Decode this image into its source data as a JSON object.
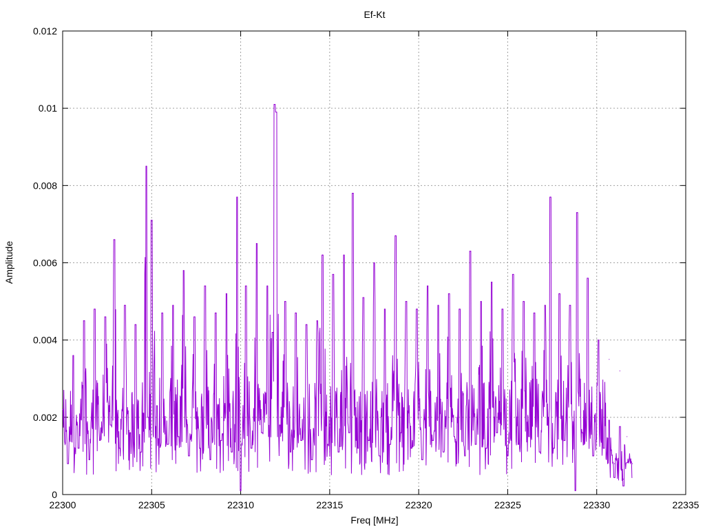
{
  "chart_data": {
    "type": "line",
    "title": "Ef-Kt",
    "xlabel": "Freq [MHz]",
    "ylabel": "Amplitude",
    "xlim": [
      22300,
      22335
    ],
    "ylim": [
      0,
      0.012
    ],
    "x_ticks": [
      "22300",
      "22305",
      "22310",
      "22315",
      "22320",
      "22325",
      "22330",
      "22335"
    ],
    "y_ticks": [
      "0",
      "0.002",
      "0.004",
      "0.006",
      "0.008",
      "0.01",
      "0.012"
    ],
    "grid": true,
    "legend": false,
    "series_color": "#9400d3",
    "x_range": [
      22300,
      22332
    ],
    "points": [
      [
        22300.0,
        0.0022
      ],
      [
        22300.3,
        0.0008
      ],
      [
        22300.6,
        0.0036
      ],
      [
        22300.9,
        0.0012
      ],
      [
        22301.2,
        0.0045
      ],
      [
        22301.5,
        0.0009
      ],
      [
        22301.8,
        0.0048
      ],
      [
        22302.1,
        0.0014
      ],
      [
        22302.4,
        0.0046
      ],
      [
        22302.7,
        0.0018
      ],
      [
        22302.9,
        0.0066
      ],
      [
        22303.2,
        0.0012
      ],
      [
        22303.5,
        0.0049
      ],
      [
        22303.8,
        0.0016
      ],
      [
        22304.1,
        0.0044
      ],
      [
        22304.4,
        0.0011
      ],
      [
        22304.7,
        0.0085
      ],
      [
        22304.8,
        0.002
      ],
      [
        22305.0,
        0.0071
      ],
      [
        22305.3,
        0.0023
      ],
      [
        22305.6,
        0.0047
      ],
      [
        22305.9,
        0.0013
      ],
      [
        22306.2,
        0.0049
      ],
      [
        22306.5,
        0.0015
      ],
      [
        22306.8,
        0.0058
      ],
      [
        22307.1,
        0.001
      ],
      [
        22307.4,
        0.0046
      ],
      [
        22307.7,
        0.0012
      ],
      [
        22308.0,
        0.0054
      ],
      [
        22308.3,
        0.0009
      ],
      [
        22308.6,
        0.0047
      ],
      [
        22308.9,
        0.0014
      ],
      [
        22309.2,
        0.0052
      ],
      [
        22309.5,
        0.0011
      ],
      [
        22309.8,
        0.0077
      ],
      [
        22310.0,
        0.0001
      ],
      [
        22310.3,
        0.0054
      ],
      [
        22310.6,
        0.0012
      ],
      [
        22310.9,
        0.0065
      ],
      [
        22311.2,
        0.0016
      ],
      [
        22311.5,
        0.0054
      ],
      [
        22311.8,
        0.0042
      ],
      [
        22311.9,
        0.0101
      ],
      [
        22312.0,
        0.0099
      ],
      [
        22312.2,
        0.0018
      ],
      [
        22312.5,
        0.005
      ],
      [
        22312.8,
        0.0011
      ],
      [
        22313.1,
        0.0047
      ],
      [
        22313.4,
        0.0014
      ],
      [
        22313.7,
        0.0044
      ],
      [
        22314.0,
        0.0009
      ],
      [
        22314.3,
        0.0045
      ],
      [
        22314.6,
        0.0062
      ],
      [
        22314.9,
        0.0013
      ],
      [
        22315.2,
        0.0057
      ],
      [
        22315.5,
        0.0011
      ],
      [
        22315.8,
        0.0062
      ],
      [
        22316.1,
        0.0016
      ],
      [
        22316.3,
        0.0078
      ],
      [
        22316.6,
        0.0012
      ],
      [
        22316.9,
        0.0051
      ],
      [
        22317.2,
        0.0014
      ],
      [
        22317.5,
        0.006
      ],
      [
        22317.8,
        0.001
      ],
      [
        22318.1,
        0.0048
      ],
      [
        22318.4,
        0.0013
      ],
      [
        22318.7,
        0.0067
      ],
      [
        22319.0,
        0.0016
      ],
      [
        22319.3,
        0.005
      ],
      [
        22319.6,
        0.0012
      ],
      [
        22319.9,
        0.0048
      ],
      [
        22320.2,
        0.0009
      ],
      [
        22320.5,
        0.0054
      ],
      [
        22320.8,
        0.0014
      ],
      [
        22321.1,
        0.0049
      ],
      [
        22321.4,
        0.0011
      ],
      [
        22321.7,
        0.0052
      ],
      [
        22322.0,
        0.0015
      ],
      [
        22322.3,
        0.0048
      ],
      [
        22322.6,
        0.001
      ],
      [
        22322.9,
        0.0063
      ],
      [
        22323.2,
        0.0013
      ],
      [
        22323.5,
        0.005
      ],
      [
        22323.8,
        0.0012
      ],
      [
        22324.1,
        0.0055
      ],
      [
        22324.4,
        0.0016
      ],
      [
        22324.7,
        0.0048
      ],
      [
        22325.0,
        0.001
      ],
      [
        22325.3,
        0.0057
      ],
      [
        22325.6,
        0.0013
      ],
      [
        22325.9,
        0.005
      ],
      [
        22326.2,
        0.0015
      ],
      [
        22326.5,
        0.0047
      ],
      [
        22326.8,
        0.0011
      ],
      [
        22327.1,
        0.0049
      ],
      [
        22327.4,
        0.0077
      ],
      [
        22327.6,
        0.0012
      ],
      [
        22327.9,
        0.0052
      ],
      [
        22328.2,
        0.0014
      ],
      [
        22328.5,
        0.0049
      ],
      [
        22328.8,
        0.0001
      ],
      [
        22328.9,
        0.0073
      ],
      [
        22329.2,
        0.0016
      ],
      [
        22329.5,
        0.0056
      ],
      [
        22329.8,
        0.001
      ],
      [
        22330.1,
        0.004
      ],
      [
        22330.4,
        0.0012
      ],
      [
        22330.7,
        0.0035
      ],
      [
        22331.0,
        0.0008
      ],
      [
        22331.3,
        0.0032
      ],
      [
        22331.5,
        0.0004
      ],
      [
        22331.7,
        0.0015
      ],
      [
        22332.0,
        0.0008
      ]
    ]
  }
}
